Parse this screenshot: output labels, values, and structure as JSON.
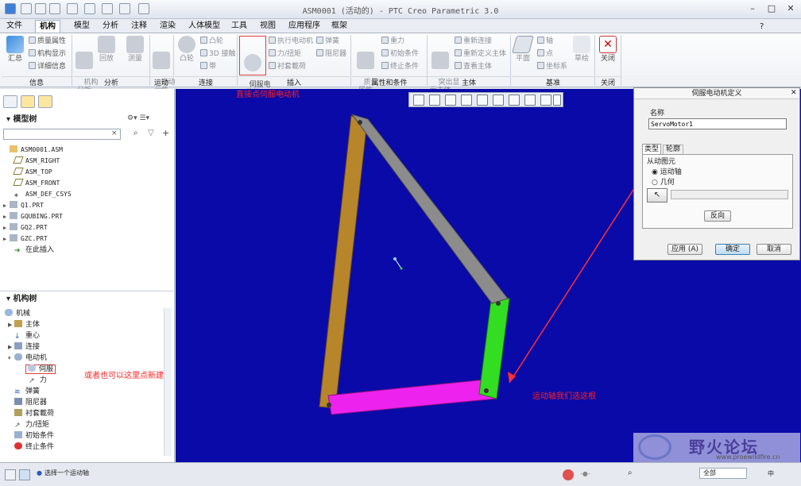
{
  "window": {
    "title": "ASM0001 (活动的) - PTC Creo Parametric 3.0",
    "help_icon": "?"
  },
  "menubar": {
    "items": [
      "文件",
      "机构",
      "模型",
      "分析",
      "注释",
      "渲染",
      "人体模型",
      "工具",
      "视图",
      "应用程序",
      "框架"
    ],
    "active_index": 1
  },
  "ribbon": {
    "groups": [
      {
        "label": "信息",
        "buttons": [
          {
            "label": "汇总"
          },
          {
            "label": "质量属性"
          },
          {
            "label": "机构显示"
          },
          {
            "label": "详细信息"
          }
        ]
      },
      {
        "label": "分析",
        "buttons": [
          {
            "label": "机构\n分析"
          },
          {
            "label": "回放"
          },
          {
            "label": "测量"
          }
        ]
      },
      {
        "label": "运动",
        "buttons": [
          {
            "label": "拖动\n元件"
          }
        ]
      },
      {
        "label": "连接",
        "buttons": [
          {
            "label": "凸轮"
          },
          {
            "label": "凸轮"
          },
          {
            "label": "3D 接触"
          },
          {
            "label": "带"
          }
        ]
      },
      {
        "label": "插入",
        "buttons": [
          {
            "label": "伺服电\n动机"
          },
          {
            "label": "执行电动机"
          },
          {
            "label": "力/扭矩"
          },
          {
            "label": "衬套載荷"
          },
          {
            "label": "弹簧"
          },
          {
            "label": "阻尼器"
          }
        ]
      },
      {
        "label": "属性和条件",
        "buttons": [
          {
            "label": "质量\n属性"
          },
          {
            "label": "重力"
          },
          {
            "label": "初始条件"
          },
          {
            "label": "终止条件"
          }
        ]
      },
      {
        "label": "主体",
        "buttons": [
          {
            "label": "突出显\n示主体"
          },
          {
            "label": "重新连接"
          },
          {
            "label": "重新定义主体"
          },
          {
            "label": "查看主体"
          }
        ]
      },
      {
        "label": "基准",
        "buttons": [
          {
            "label": "平面"
          },
          {
            "label": "轴"
          },
          {
            "label": "点"
          },
          {
            "label": "坐标系"
          },
          {
            "label": "草绘"
          }
        ]
      },
      {
        "label": "关闭",
        "buttons": [
          {
            "label": "关闭"
          }
        ]
      }
    ]
  },
  "model_tree": {
    "header": "模型树",
    "items": [
      "ASM0001.ASM",
      "ASM_RIGHT",
      "ASM_TOP",
      "ASM_FRONT",
      "ASM_DEF_CSYS",
      "Q1.PRT",
      "GQUBING.PRT",
      "GQ2.PRT",
      "GZC.PRT",
      "在此插入"
    ]
  },
  "mech_tree": {
    "header": "机构树",
    "items": [
      "机械",
      "主体",
      "重心",
      "连接",
      "电动机",
      "伺服",
      "力",
      "弹簧",
      "阻尼器",
      "衬套載荷",
      "力/扭矩",
      "初始条件",
      "终止条件"
    ]
  },
  "annotations": {
    "a1": "直接点伺服电动机",
    "a2": "或者也可以这里点新建",
    "a3": "运动轴我们选这根"
  },
  "dialog": {
    "title": "伺服电动机定义",
    "name_label": "名称",
    "name_value": "ServoMotor1",
    "tabs": [
      "类型",
      "轮廓"
    ],
    "section": "从动图元",
    "radio1": "运动轴",
    "radio2": "几何",
    "reverse": "反向",
    "apply": "应用 (A)",
    "ok": "确定",
    "cancel": "取消"
  },
  "status": {
    "message": "选择一个运动轴",
    "filter": "全部",
    "ime": "中"
  },
  "watermark": {
    "text": "野火论坛",
    "url": "www.proewildfire.cn"
  },
  "colors": {
    "viewport": "#0a0aa8",
    "link_tan": "#b8862a",
    "link_gray": "#8c8c8c",
    "link_green": "#33dd22",
    "link_magenta": "#ee22ee",
    "annotation": "#ff2020"
  }
}
